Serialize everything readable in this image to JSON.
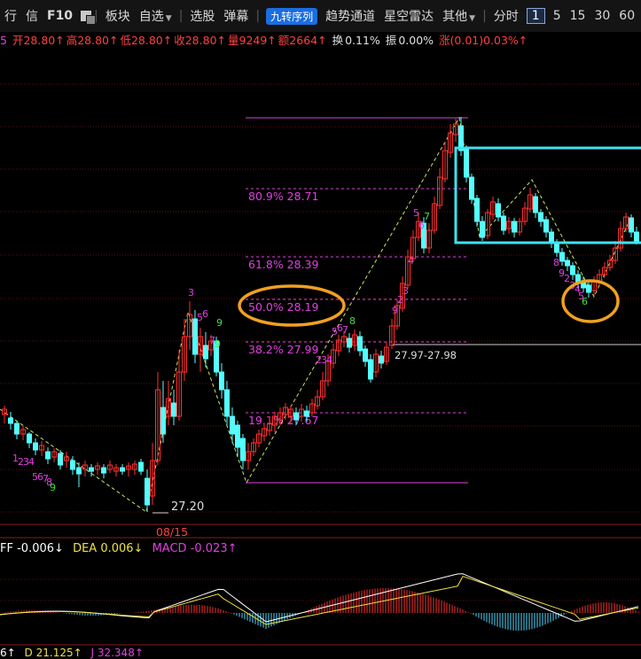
{
  "toolbar": {
    "items": [
      "行",
      "信",
      "F10",
      "板块",
      "自选",
      "选股",
      "弹幕",
      "九转序列",
      "趋势通道",
      "星空雷达",
      "其他",
      "分时",
      "1",
      "5",
      "15",
      "30",
      "60"
    ]
  },
  "infobar": {
    "prefix": "5",
    "open": "开28.80↑",
    "high": "高28.80↑",
    "low": "低28.80↑",
    "close": "收28.80↑",
    "volume": "量9249↑",
    "amount": "额2664↑",
    "turnover_label": "换",
    "turnover": "0.11%",
    "amplitude_label": "振",
    "amplitude": "0.00%",
    "change": "涨(0.01)0.03%↑"
  },
  "chart_data": {
    "type": "candlestick",
    "fib_levels": [
      {
        "label": "80.9% 28.71"
      },
      {
        "label": "61.8% 28.39"
      },
      {
        "label": "50.0% 28.19"
      },
      {
        "label": "38.2% 27.99"
      },
      {
        "label": "19.1% 27.67"
      }
    ],
    "low_label": "27.20",
    "range_label": "27.97-27.98",
    "date_label": "08/15",
    "td_counts": [
      "1",
      "2",
      "3",
      "4",
      "5",
      "6",
      "7",
      "8",
      "9",
      "3",
      "5",
      "6",
      "9",
      "7",
      "9",
      "2",
      "3",
      "4",
      "5",
      "6",
      "7",
      "8",
      "9",
      "2",
      "3",
      "4",
      "5",
      "6",
      "7",
      "8",
      "9",
      "2",
      "3",
      "4",
      "5",
      "6",
      "7",
      "8",
      "9"
    ],
    "colors": {
      "up": "#ff3030",
      "down": "#54ffff",
      "fib": "#e040e0",
      "channel": "#40e0f0",
      "circle": "#f0a020"
    }
  },
  "macd": {
    "diff_label": "FF",
    "diff_value": "-0.006↓",
    "dea_label": "DEA",
    "dea_value": "0.006↓",
    "macd_label": "MACD",
    "macd_value": "-0.023↑"
  },
  "kdj": {
    "k_label": "6↑",
    "d_label": "D",
    "d_value": "21.125↑",
    "j_value": "J 32.348↑"
  }
}
